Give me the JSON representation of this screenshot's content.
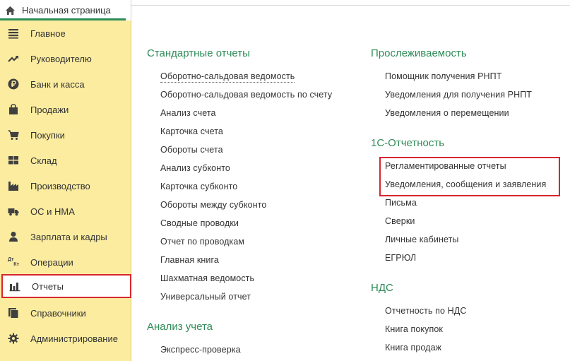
{
  "tab": {
    "home_label": "Начальная страница"
  },
  "sidebar": {
    "items": [
      {
        "label": "Главное",
        "icon": "menu-lines-icon"
      },
      {
        "label": "Руководителю",
        "icon": "trend-icon"
      },
      {
        "label": "Банк и касса",
        "icon": "ruble-coin-icon"
      },
      {
        "label": "Продажи",
        "icon": "shopping-bag-icon"
      },
      {
        "label": "Покупки",
        "icon": "cart-icon"
      },
      {
        "label": "Склад",
        "icon": "warehouse-grid-icon"
      },
      {
        "label": "Производство",
        "icon": "factory-icon"
      },
      {
        "label": "ОС и НМА",
        "icon": "truck-icon"
      },
      {
        "label": "Зарплата и кадры",
        "icon": "person-icon"
      },
      {
        "label": "Операции",
        "icon": "dt-kt-icon",
        "icon_text": [
          "Дт",
          "Кт"
        ]
      },
      {
        "label": "Отчеты",
        "icon": "bar-chart-icon"
      },
      {
        "label": "Справочники",
        "icon": "books-icon"
      },
      {
        "label": "Администрирование",
        "icon": "gear-icon"
      }
    ],
    "selected": "Отчеты"
  },
  "main": {
    "standard": {
      "title": "Стандартные отчеты",
      "items": [
        "Оборотно-сальдовая ведомость",
        "Оборотно-сальдовая ведомость по счету",
        "Анализ счета",
        "Карточка счета",
        "Обороты счета",
        "Анализ субконто",
        "Карточка субконто",
        "Обороты между субконто",
        "Сводные проводки",
        "Отчет по проводкам",
        "Главная книга",
        "Шахматная ведомость",
        "Универсальный отчет"
      ]
    },
    "analysis": {
      "title": "Анализ учета",
      "items": [
        "Экспресс-проверка"
      ]
    },
    "traceability": {
      "title": "Прослеживаемость",
      "items": [
        "Помощник получения РНПТ",
        "Уведомления для получения РНПТ",
        "Уведомления о перемещении"
      ]
    },
    "reporting": {
      "title": "1С-Отчетность",
      "items": [
        "Регламентированные отчеты",
        "Уведомления, сообщения и заявления",
        "Письма",
        "Сверки",
        "Личные кабинеты",
        "ЕГРЮЛ"
      ]
    },
    "vat": {
      "title": "НДС",
      "items": [
        "Отчетность по НДС",
        "Книга покупок",
        "Книга продаж"
      ]
    }
  },
  "colors": {
    "sidebar_bg": "#fbeca0",
    "section_title": "#2e8b57",
    "highlight": "#d7262f",
    "tab_underline": "#2e8b57"
  }
}
